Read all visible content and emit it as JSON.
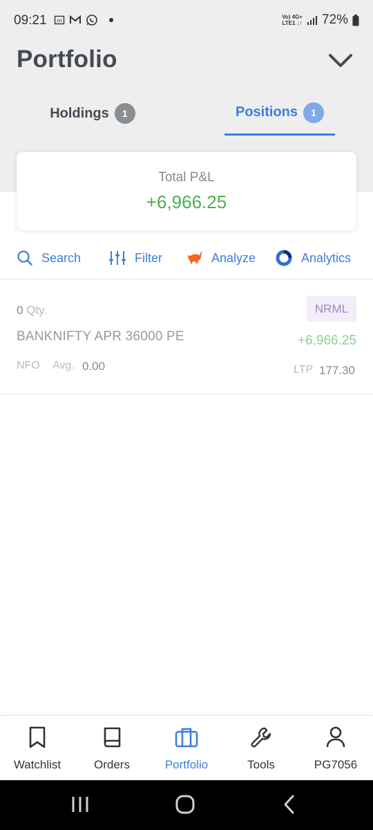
{
  "status_bar": {
    "time": "09:21",
    "network_line1": "Vo) 4G+",
    "network_line2": "LTE1 ↓↑",
    "battery": "72%"
  },
  "header": {
    "title": "Portfolio",
    "tabs": [
      {
        "label": "Holdings",
        "count": "1",
        "active": false
      },
      {
        "label": "Positions",
        "count": "1",
        "active": true
      }
    ]
  },
  "pnl_card": {
    "label": "Total P&L",
    "value": "+6,966.25"
  },
  "toolbar": {
    "search": "Search",
    "filter": "Filter",
    "analyze": "Analyze",
    "analytics": "Analytics"
  },
  "positions": [
    {
      "qty": "0",
      "qty_unit": "Qty.",
      "product": "NRML",
      "instrument": "BANKNIFTY APR 36000 PE",
      "pnl": "+6,966.25",
      "exchange": "NFO",
      "avg_label": "Avg.",
      "avg": "0.00",
      "ltp_label": "LTP",
      "ltp": "177.30"
    }
  ],
  "bottom_nav": [
    {
      "label": "Watchlist",
      "icon": "bookmark-icon"
    },
    {
      "label": "Orders",
      "icon": "book-icon"
    },
    {
      "label": "Portfolio",
      "icon": "briefcase-icon",
      "active": true
    },
    {
      "label": "Tools",
      "icon": "wrench-icon"
    },
    {
      "label": "PG7056",
      "icon": "user-icon"
    }
  ],
  "colors": {
    "accent": "#3f7ddc",
    "profit": "#4caf50",
    "header_bg": "#eeeeee",
    "product_tag": "#a684c9"
  }
}
